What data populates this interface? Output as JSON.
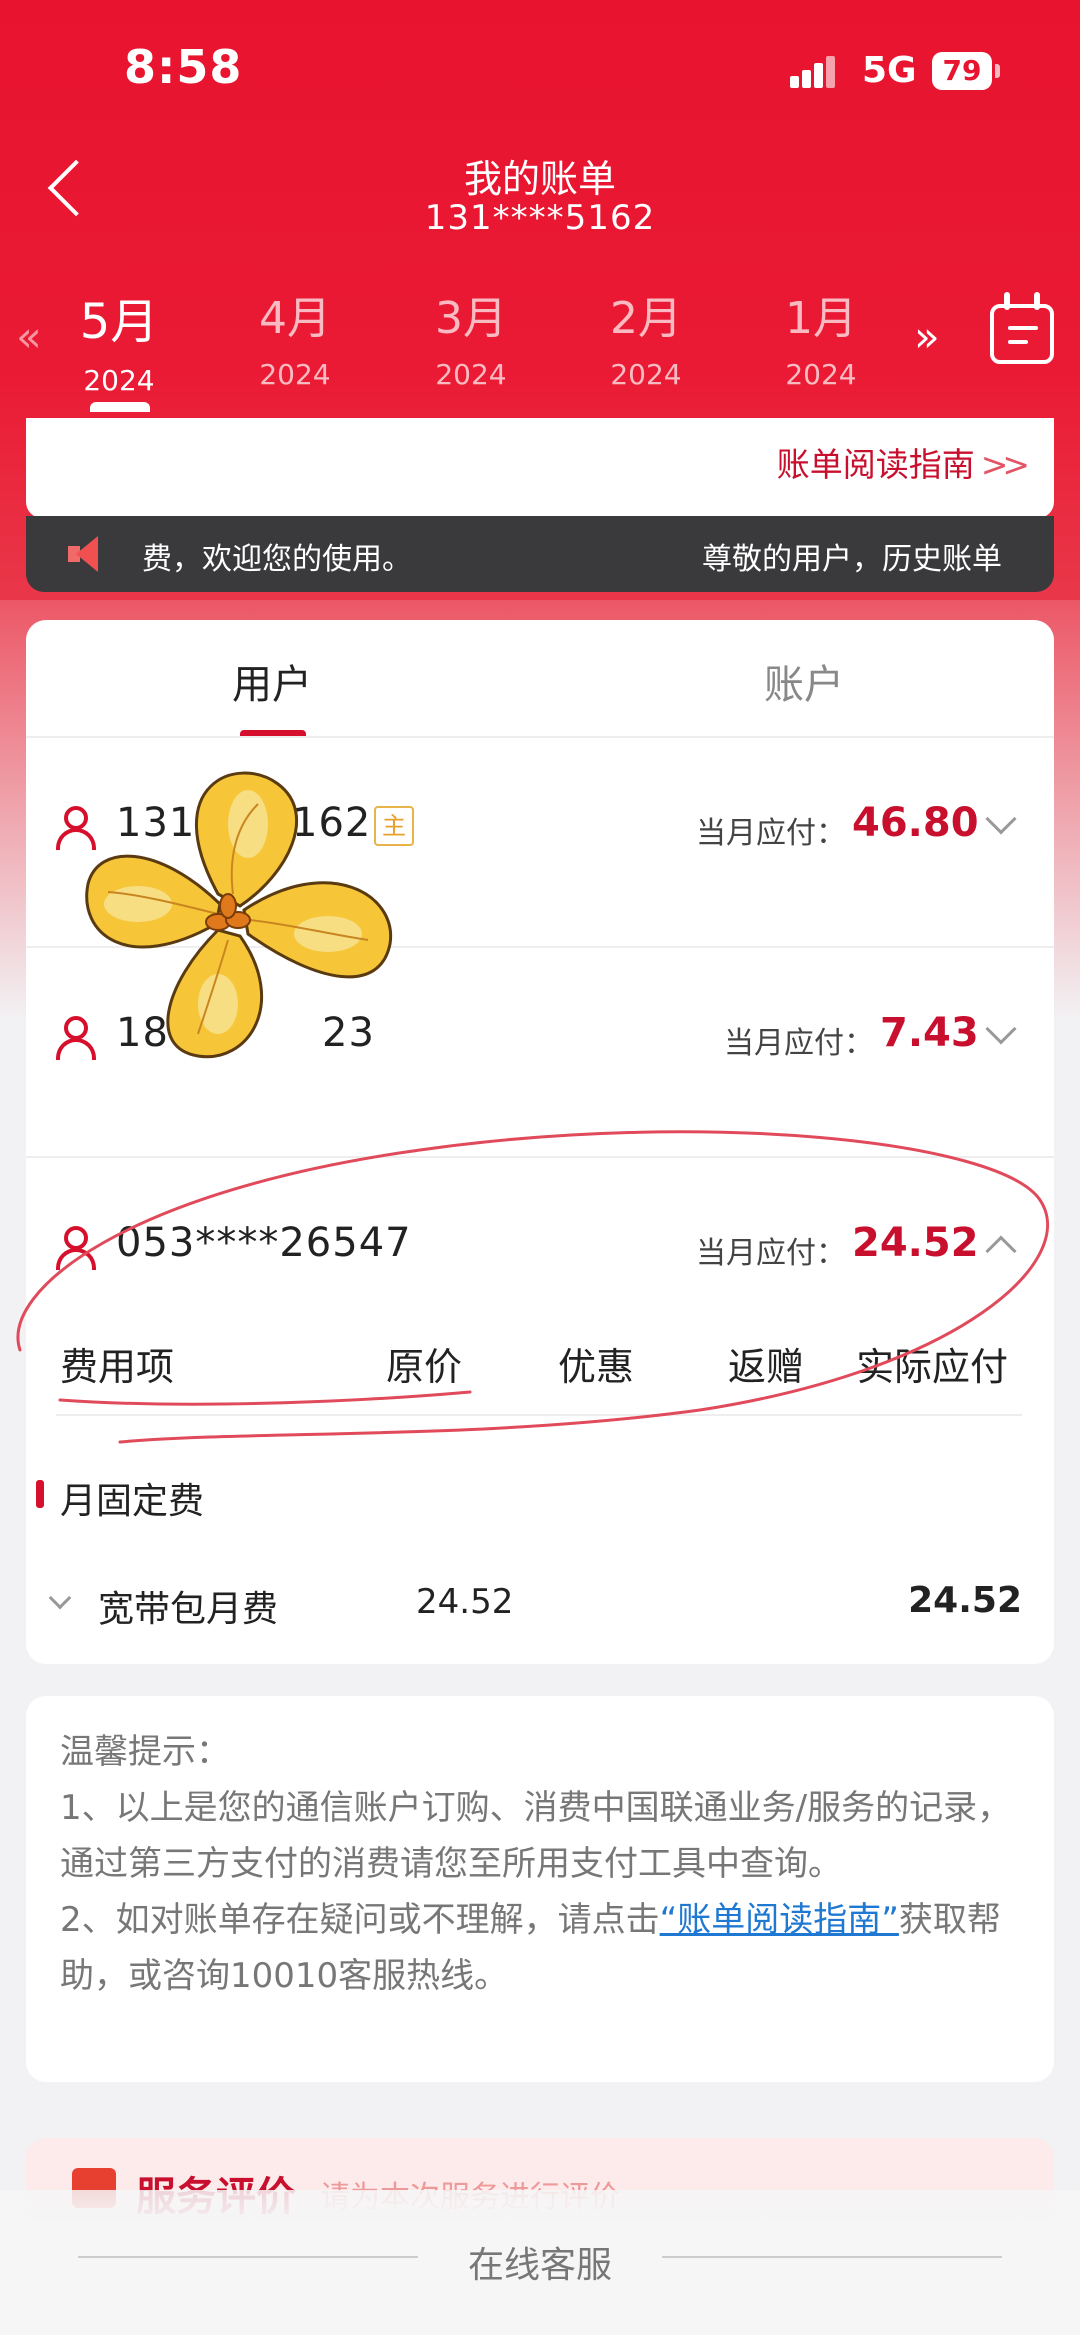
{
  "status_bar": {
    "time": "8:58",
    "network": "5G",
    "battery": "79"
  },
  "header": {
    "title": "我的账单",
    "phone": "131****5162"
  },
  "months": [
    {
      "month": "5月",
      "year": "2024"
    },
    {
      "month": "4月",
      "year": "2024"
    },
    {
      "month": "3月",
      "year": "2024"
    },
    {
      "month": "2月",
      "year": "2024"
    },
    {
      "month": "1月",
      "year": "2024"
    }
  ],
  "month_nav": {
    "prev": "«",
    "next": "»"
  },
  "guide": {
    "label": "账单阅读指南",
    "chevrons": ">>"
  },
  "notice": {
    "left_text": "费，欢迎您的使用。",
    "right_text": "尊敬的用户，历史账单"
  },
  "tabs": {
    "user": "用户",
    "account": "账户"
  },
  "users": [
    {
      "phone_start": "131",
      "phone_end": "162",
      "badge": "主",
      "due_label": "当月应付：",
      "due_amount": "46.80"
    },
    {
      "phone_start": "186",
      "phone_end": "23",
      "due_label": "当月应付：",
      "due_amount": "7.43"
    },
    {
      "phone": "053****26547",
      "due_label": "当月应付：",
      "due_amount": "24.52"
    }
  ],
  "table": {
    "headers": [
      "费用项",
      "原价",
      "优惠",
      "返赠",
      "实际应付"
    ],
    "group": "月固定费",
    "row": {
      "name": "宽带包月费",
      "original": "24.52",
      "actual": "24.52"
    }
  },
  "tips": {
    "title": "温馨提示：",
    "line1": "1、以上是您的通信账户订购、消费中国联通业务/服务的记录，通过第三方支付的消费请您至所用支付工具中查询。",
    "line2_pre": "2、如对账单存在疑问或不理解，请点击",
    "line2_link": "“账单阅读指南”",
    "line2_post": "获取帮助，或咨询10010客服热线。"
  },
  "service_eval": {
    "title": "服务评价",
    "subtitle": "请为本次服务进行评价"
  },
  "bottom": {
    "label": "在线客服"
  }
}
